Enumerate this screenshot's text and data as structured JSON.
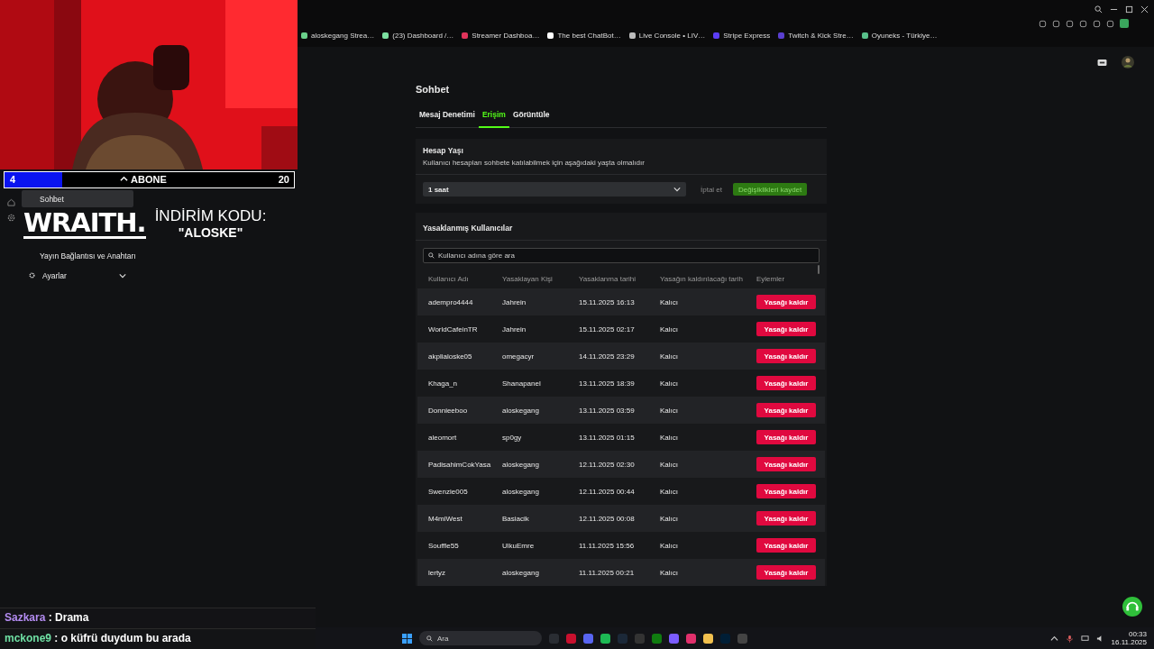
{
  "bookmarks": [
    "aloskegang Strea…",
    "(23) Dashboard /…",
    "Streamer Dashboa…",
    "The best ChatBot…",
    "Live Console • LIV…",
    "Stripe Express",
    "Twitch & Kick Stre…",
    "Oyuneks - Türkiye…"
  ],
  "sidebar": {
    "items": [
      {
        "label": "Sohbet",
        "kind": "link",
        "selected": true
      },
      {
        "label": "Yayın Bağlantısı ve Anahtarı",
        "kind": "link",
        "selected": false
      },
      {
        "label": "Ayarlar",
        "kind": "group",
        "selected": false,
        "expanded": false
      }
    ]
  },
  "page": {
    "title": "Sohbet",
    "tabs": [
      {
        "label": "Mesaj Denetimi",
        "selected": false
      },
      {
        "label": "Erişim",
        "selected": true
      },
      {
        "label": "Görüntüle",
        "selected": false
      }
    ],
    "account_age": {
      "title": "Hesap Yaşı",
      "description": "Kullanıcı hesapları sohbete katılabilmek için aşağıdaki yaşta olmalıdır",
      "value": "1 saat",
      "cancel": "İptal et",
      "save": "Değişiklikleri kaydet"
    },
    "banned": {
      "title": "Yasaklanmış Kullanıcılar",
      "search_placeholder": "Kullanıcı adına göre ara",
      "columns": [
        "Kullanıcı Adı",
        "Yasaklayan Kişi",
        "Yasaklanma tarihi",
        "Yasağın kaldırılacağı tarih",
        "Eylemler"
      ],
      "rows": [
        {
          "user": "adempro4444",
          "by": "Jahrein",
          "date": "15.11.2025 16:13",
          "until": "Kalıcı",
          "action": "Yasağı kaldır"
        },
        {
          "user": "WorldCafeinTR",
          "by": "Jahrein",
          "date": "15.11.2025 02:17",
          "until": "Kalıcı",
          "action": "Yasağı kaldır"
        },
        {
          "user": "akplialoske05",
          "by": "omegacyr",
          "date": "14.11.2025 23:29",
          "until": "Kalıcı",
          "action": "Yasağı kaldır"
        },
        {
          "user": "Khaga_n",
          "by": "Shanapanel",
          "date": "13.11.2025 18:39",
          "until": "Kalıcı",
          "action": "Yasağı kaldır"
        },
        {
          "user": "Donnieeboo",
          "by": "aloskegang",
          "date": "13.11.2025 03:59",
          "until": "Kalıcı",
          "action": "Yasağı kaldır"
        },
        {
          "user": "aleomort",
          "by": "sp0gy",
          "date": "13.11.2025 01:15",
          "until": "Kalıcı",
          "action": "Yasağı kaldır"
        },
        {
          "user": "PadisahimCokYasa",
          "by": "aloskegang",
          "date": "12.11.2025 02:30",
          "until": "Kalıcı",
          "action": "Yasağı kaldır"
        },
        {
          "user": "Swenzie005",
          "by": "aloskegang",
          "date": "12.11.2025 00:44",
          "until": "Kalıcı",
          "action": "Yasağı kaldır"
        },
        {
          "user": "M4miWest",
          "by": "Basiacik",
          "date": "12.11.2025 00:08",
          "until": "Kalıcı",
          "action": "Yasağı kaldır"
        },
        {
          "user": "Souffle55",
          "by": "UlkuEmre",
          "date": "11.11.2025 15:56",
          "until": "Kalıcı",
          "action": "Yasağı kaldır"
        },
        {
          "user": "lertyz",
          "by": "aloskegang",
          "date": "11.11.2025 00:21",
          "until": "Kalıcı",
          "action": "Yasağı kaldır"
        }
      ]
    }
  },
  "stream_overlay": {
    "sub_goal": {
      "current": "4",
      "label": "ABONE",
      "target": "20",
      "level": 0.2
    },
    "ad": {
      "brand": "WRAITH.",
      "line1": "İNDİRİM KODU:",
      "line2": "\"ALOSKE\""
    },
    "chat": [
      {
        "user": "Sazkara",
        "color": "#b48cf2",
        "text": ": Drama"
      },
      {
        "user": "mckone9",
        "color": "#6fe0a4",
        "text": ": o küfrü duydum bu arada"
      }
    ]
  },
  "taskbar": {
    "search_placeholder": "Ara",
    "time": "00:33",
    "date": "16.11.2025"
  }
}
